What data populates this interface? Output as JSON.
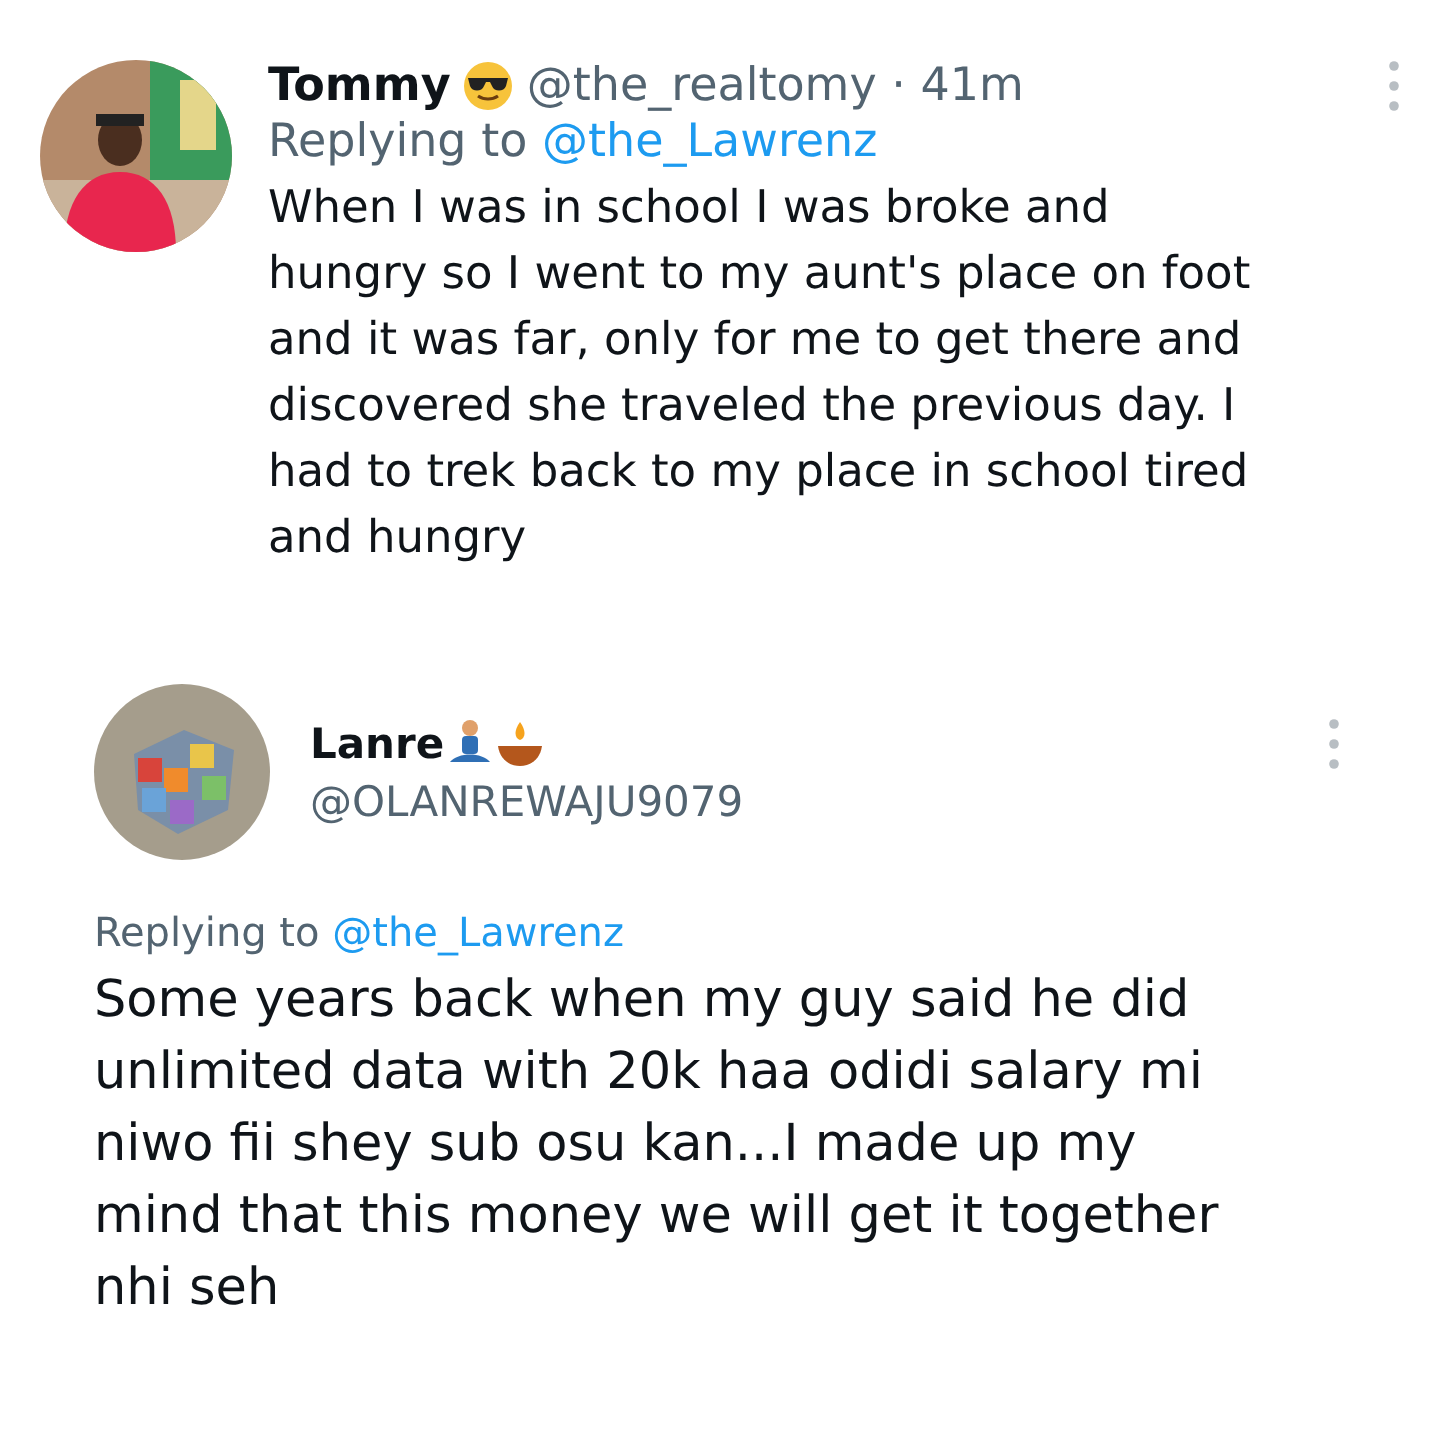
{
  "tweets": [
    {
      "kind": "compact",
      "name": "Tommy",
      "handle": "@the_realtomy",
      "separator": "·",
      "time": "41m",
      "replying_label": "Replying to",
      "replying_to": "@the_Lawrenz",
      "body_lines": [
        "When I was in school I was broke and",
        "hungry so I went to my aunt's place on foot",
        "and it was far, only for me to get there and",
        "discovered she traveled the previous day. I",
        "had to trek back to my place in school tired",
        "and hungry"
      ]
    },
    {
      "kind": "expanded",
      "name": "Lanre",
      "handle": "@OLANREWAJU9079",
      "replying_label": "Replying to",
      "replying_to": "@the_Lawrenz",
      "body_lines": [
        "Some years back when my guy said he did",
        "unlimited data with 20k haa odidi salary mi",
        "niwo fii shey sub osu kan...I made up my",
        "mind that this money we will get it together",
        "nhi seh"
      ]
    }
  ]
}
